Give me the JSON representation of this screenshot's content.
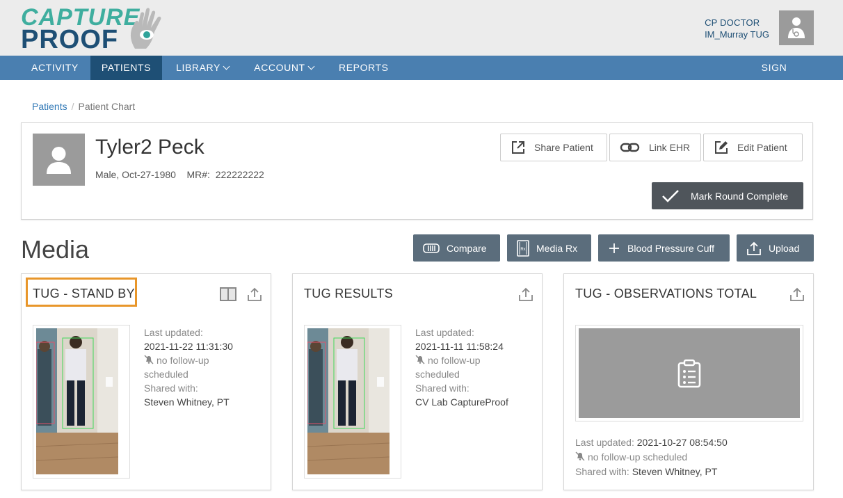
{
  "logo": {
    "line1": "CAPTURE",
    "line2": "PROOF"
  },
  "user": {
    "role": "CP DOCTOR",
    "name": "IM_Murray TUG"
  },
  "nav": {
    "activity": "ACTIVITY",
    "patients": "PATIENTS",
    "library": "LIBRARY",
    "account": "ACCOUNT",
    "reports": "REPORTS",
    "sign_out": "SIGN OUT"
  },
  "breadcrumb": {
    "link": "Patients",
    "separator": "/",
    "current": "Patient Chart"
  },
  "patient": {
    "name": "Tyler2 Peck",
    "info": "Male, Oct-27-1980    MR#:  222222222",
    "buttons": {
      "share": "Share Patient",
      "link_ehr": "Link EHR",
      "edit": "Edit Patient",
      "mark_round": "Mark Round Complete"
    }
  },
  "media": {
    "title": "Media",
    "buttons": {
      "compare": "Compare",
      "media_rx": "Media Rx",
      "blood_pressure": "Blood Pressure Cuff",
      "upload": "Upload"
    },
    "cards": [
      {
        "title": "TUG - STAND BY",
        "last_updated_label": "Last updated:",
        "last_updated": "2021-11-22 11:31:30",
        "followup": "no follow-up",
        "followup2": "scheduled",
        "shared_label": "Shared with:",
        "shared_with": "Steven Whitney, PT"
      },
      {
        "title": "TUG RESULTS",
        "last_updated_label": "Last updated:",
        "last_updated": "2021-11-11 11:58:24",
        "followup": "no follow-up",
        "followup2": "scheduled",
        "shared_label": "Shared with:",
        "shared_with": "CV Lab CaptureProof"
      },
      {
        "title": "TUG - OBSERVATIONS TOTAL",
        "last_updated_label": "Last updated:",
        "last_updated": "2021-10-27 08:54:50",
        "followup": "no follow-up scheduled",
        "shared_label": "Shared with:",
        "shared_with": "Steven Whitney, PT"
      }
    ]
  },
  "colors": {
    "nav_bg": "#4a7fb0",
    "nav_active": "#1e4f75",
    "highlight": "#e8962a",
    "slate_button": "#5b6d7c",
    "dark_button": "#4f555b"
  }
}
